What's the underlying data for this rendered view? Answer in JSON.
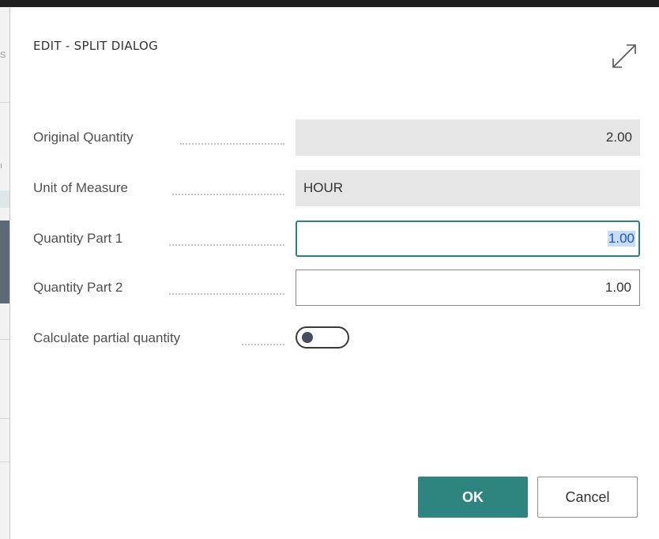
{
  "dialog": {
    "title": "EDIT - SPLIT DIALOG",
    "expand_icon": "expand-diagonal-icon"
  },
  "fields": {
    "original_quantity": {
      "label": "Original Quantity",
      "value": "2.00"
    },
    "unit_of_measure": {
      "label": "Unit of Measure",
      "value": "HOUR"
    },
    "quantity_part_1": {
      "label": "Quantity Part 1",
      "value": "1.00"
    },
    "quantity_part_2": {
      "label": "Quantity Part 2",
      "value": "1.00"
    },
    "calculate_partial": {
      "label": "Calculate partial quantity",
      "value": false
    }
  },
  "buttons": {
    "ok": "OK",
    "cancel": "Cancel"
  },
  "colors": {
    "accent": "#2e8580",
    "focus_border": "#2f7d7d",
    "readonly_bg": "#e6e6e6"
  }
}
